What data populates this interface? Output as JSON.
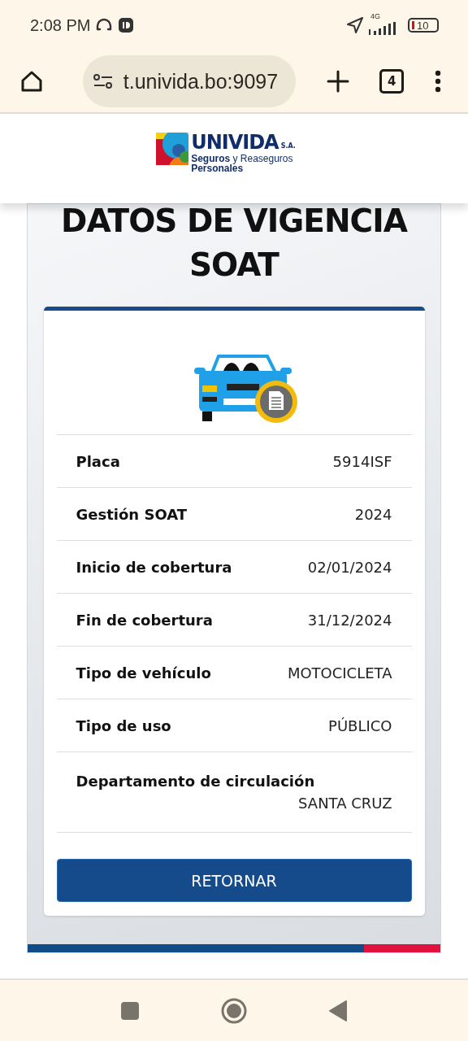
{
  "status_bar": {
    "time": "2:08 PM",
    "network": "4G",
    "battery": "10"
  },
  "browser": {
    "url": "t.univida.bo:9097",
    "tab_count": "4"
  },
  "logo": {
    "name": "UNIVIDA",
    "suffix": "S.A.",
    "tagline_bold": "Seguros",
    "tagline": "y Reaseguros",
    "tagline_line2": "Personales"
  },
  "title": "DATOS DE VIGENCIA SOAT",
  "rows": [
    {
      "label": "Placa",
      "value": "5914ISF",
      "kind": "inline"
    },
    {
      "label": "Gestión SOAT",
      "value": "2024",
      "kind": "inline"
    },
    {
      "label": "Inicio de cobertura",
      "value": "02/01/2024",
      "kind": "inline"
    },
    {
      "label": "Fin de cobertura",
      "value": "31/12/2024",
      "kind": "inline"
    },
    {
      "label": "Tipo de vehículo",
      "value": "MOTOCICLETA",
      "kind": "inline"
    },
    {
      "label": "Tipo de uso",
      "value": "PÚBLICO",
      "kind": "inline"
    },
    {
      "label": "Departamento de circulación",
      "value": "SANTA CRUZ",
      "kind": "stacked"
    }
  ],
  "button": "RETORNAR"
}
